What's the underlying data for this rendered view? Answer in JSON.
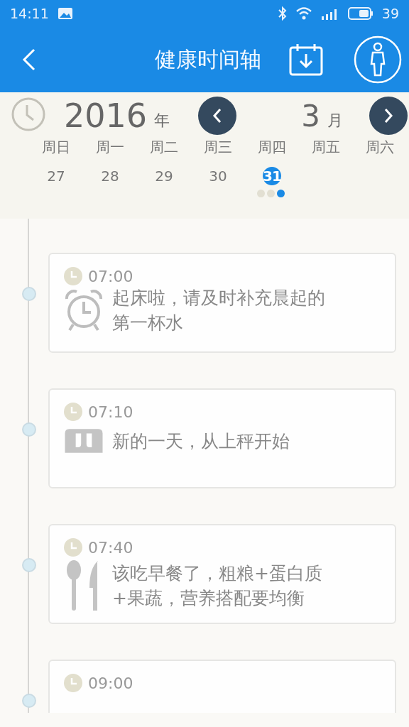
{
  "status_bar": {
    "time": "14:11",
    "battery": "39"
  },
  "header": {
    "title": "健康时间轴"
  },
  "calendar": {
    "year": "2016",
    "year_unit": "年",
    "month": "3",
    "month_unit": "月",
    "weekdays": [
      "周日",
      "周一",
      "周二",
      "周三",
      "周四",
      "周五",
      "周六"
    ],
    "days": [
      {
        "label": "27",
        "selected": false
      },
      {
        "label": "28",
        "selected": false
      },
      {
        "label": "29",
        "selected": false
      },
      {
        "label": "30",
        "selected": false
      },
      {
        "label": "31",
        "selected": true
      }
    ],
    "pager_dots": [
      {
        "selected": false
      },
      {
        "selected": false
      },
      {
        "selected": true
      }
    ]
  },
  "timeline": [
    {
      "time": "07:00",
      "kind": "alarm",
      "message": "起床啦，请及时补充晨起的第一杯水"
    },
    {
      "time": "07:10",
      "kind": "scale",
      "message": "新的一天，从上秤开始"
    },
    {
      "time": "07:40",
      "kind": "meal",
      "message": "该吃早餐了，粗粮+蛋白质+果蔬，营养搭配要均衡"
    },
    {
      "time": "09:00"
    }
  ]
}
